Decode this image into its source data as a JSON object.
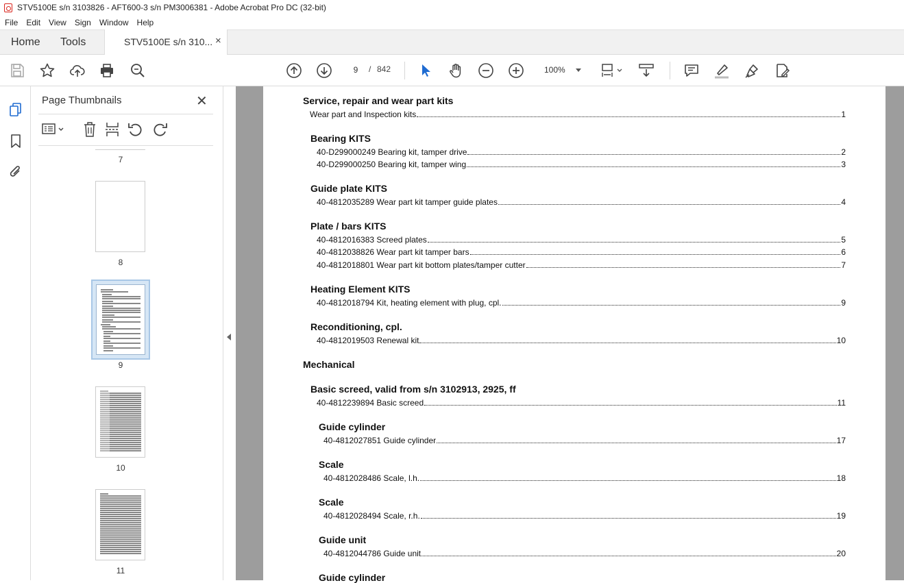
{
  "window": {
    "title": "STV5100E s/n 3103826 - AFT600-3 s/n PM3006381 - Adobe Acrobat Pro DC (32-bit)"
  },
  "menu": [
    "File",
    "Edit",
    "View",
    "Sign",
    "Window",
    "Help"
  ],
  "tabs": {
    "home": "Home",
    "tools": "Tools",
    "doc": "STV5100E s/n 310...",
    "close": "×"
  },
  "toolbar": {
    "current_page": "9",
    "separator": "/",
    "total_pages": "842",
    "zoom": "100%"
  },
  "panel": {
    "title": "Page Thumbnails",
    "close": "✕"
  },
  "thumbnails": [
    {
      "num": "7"
    },
    {
      "num": "8"
    },
    {
      "num": "9",
      "selected": true
    },
    {
      "num": "10"
    },
    {
      "num": "11"
    }
  ],
  "document": {
    "sections": [
      {
        "type": "h1",
        "text": "Service, repair and wear part kits"
      },
      {
        "type": "entry1",
        "text": "Wear part and Inspection kits",
        "page": "1"
      },
      {
        "type": "h2",
        "text": "Bearing KITS"
      },
      {
        "type": "entry2",
        "text": "40-D299000249 Bearing kit, tamper drive",
        "page": "2"
      },
      {
        "type": "entry2",
        "text": "40-D299000250 Bearing kit, tamper wing",
        "page": "3"
      },
      {
        "type": "h2",
        "text": "Guide plate KITS"
      },
      {
        "type": "entry2",
        "text": "40-4812035289 Wear part kit tamper guide plates",
        "page": "4"
      },
      {
        "type": "h2",
        "text": "Plate / bars KITS"
      },
      {
        "type": "entry2",
        "text": "40-4812016383 Screed plates",
        "page": "5"
      },
      {
        "type": "entry2",
        "text": "40-4812038826 Wear part kit tamper bars",
        "page": "6"
      },
      {
        "type": "entry2",
        "text": "40-4812018801 Wear part kit bottom plates/tamper cutter",
        "page": "7"
      },
      {
        "type": "h2",
        "text": "Heating Element KITS"
      },
      {
        "type": "entry2",
        "text": "40-4812018794 Kit, heating element with plug, cpl.",
        "page": "9"
      },
      {
        "type": "h2",
        "text": "Reconditioning, cpl."
      },
      {
        "type": "entry2",
        "text": "40-4812019503 Renewal kit",
        "page": "10"
      },
      {
        "type": "h1",
        "text": "Mechanical"
      },
      {
        "type": "h2",
        "text": "Basic screed, valid from s/n 3102913, 2925, ff"
      },
      {
        "type": "entry2",
        "text": "40-4812239894 Basic screed",
        "page": "11"
      },
      {
        "type": "h3",
        "text": "Guide cylinder"
      },
      {
        "type": "entry3",
        "text": "40-4812027851 Guide cylinder",
        "page": "17"
      },
      {
        "type": "h3",
        "text": "Scale"
      },
      {
        "type": "entry3",
        "text": "40-4812028486 Scale, l.h.",
        "page": "18"
      },
      {
        "type": "h3",
        "text": "Scale"
      },
      {
        "type": "entry3",
        "text": "40-4812028494 Scale, r.h.",
        "page": "19"
      },
      {
        "type": "h3",
        "text": "Guide unit"
      },
      {
        "type": "entry3",
        "text": "40-4812044786 Guide unit",
        "page": "20"
      },
      {
        "type": "h3",
        "text": "Guide cylinder"
      }
    ]
  }
}
